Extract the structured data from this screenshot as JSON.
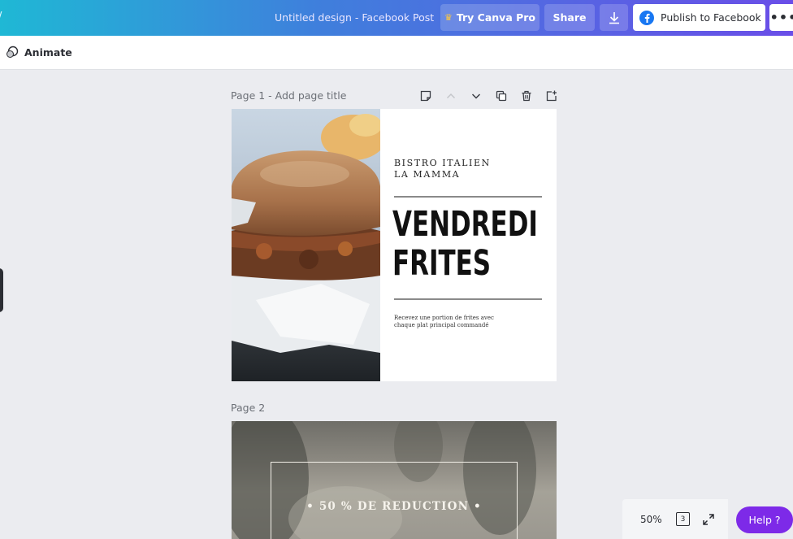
{
  "header": {
    "edge_glyph": "/",
    "doc_title": "Untitled design - Facebook Post",
    "try_pro_label": "Try Canva Pro",
    "share_label": "Share",
    "publish_label": "Publish to Facebook",
    "more_label": "•••"
  },
  "toolbar": {
    "animate_label": "Animate"
  },
  "pages": [
    {
      "label": "Page 1 - Add page title",
      "bistro_line1": "BISTRO ITALIEN",
      "bistro_line2": "LA MAMMA",
      "headline_line1": "VENDREDI",
      "headline_line2": "FRITES",
      "body_text": "Recevez une portion de frites avec chaque plat principal commandé"
    },
    {
      "label": "Page 2",
      "promo_text": "• 50 % DE REDUCTION •"
    }
  ],
  "footer": {
    "zoom": "50%",
    "page_count": "3",
    "help_label": "Help ?"
  },
  "colors": {
    "header_gradient_start": "#1fb8d5",
    "header_gradient_end": "#6a4ee8",
    "help_button": "#7d2ae8",
    "facebook_blue": "#1877f2",
    "pro_crown": "#ffc93c"
  }
}
